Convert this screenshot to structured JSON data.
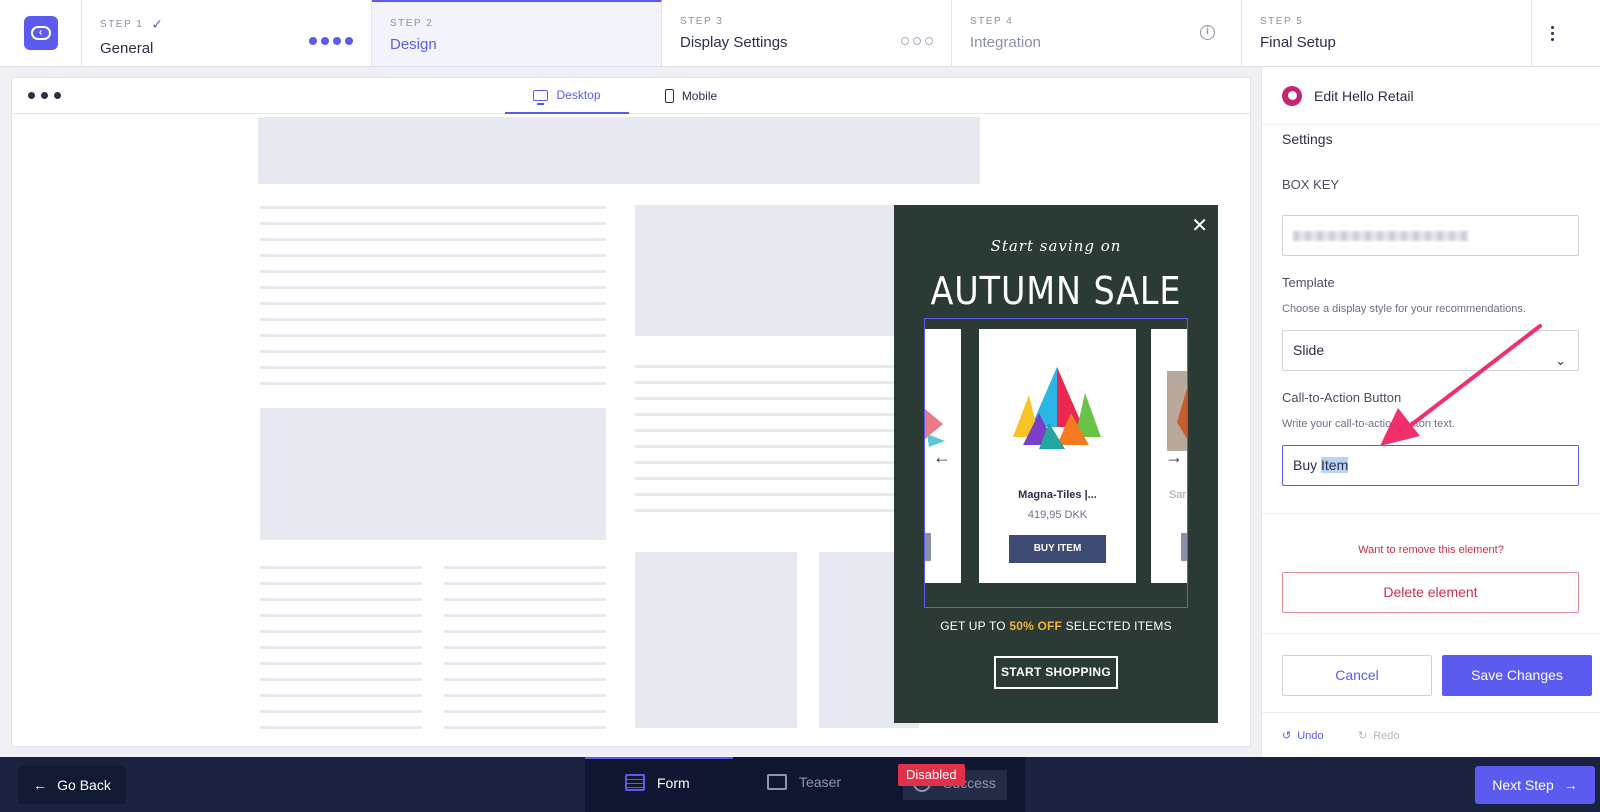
{
  "steps": [
    {
      "num": "STEP 1",
      "name": "General"
    },
    {
      "num": "STEP 2",
      "name": "Design"
    },
    {
      "num": "STEP 3",
      "name": "Display Settings"
    },
    {
      "num": "STEP 4",
      "name": "Integration"
    },
    {
      "num": "STEP 5",
      "name": "Final Setup"
    }
  ],
  "preview": {
    "tabs": {
      "desktop": "Desktop",
      "mobile": "Mobile"
    },
    "popup": {
      "pretitle": "Start saving on",
      "title": "AUTUMN SALE",
      "product_name": "Magna-Tiles |...",
      "product_price": "419,95 DKK",
      "buy_label": "BUY ITEM",
      "side_peek_text": "Sar",
      "promo_prefix": "GET UP TO ",
      "promo_highlight": "50% OFF",
      "promo_suffix": " SELECTED ITEMS",
      "shop_label": "START SHOPPING",
      "prev_arrow": "←",
      "next_arrow": "→"
    }
  },
  "editor": {
    "title": "Edit Hello Retail",
    "section": "Settings",
    "box_key_label": "BOX KEY",
    "template_label": "Template",
    "template_hint": "Choose a display style for your recommendations.",
    "template_value": "Slide",
    "cta_label": "Call-to-Action Button",
    "cta_hint": "Write your call-to-action button text.",
    "cta_value_plain": "Buy ",
    "cta_value_selected": "Item",
    "remove_question": "Want to remove this element?",
    "delete_label": "Delete element",
    "cancel_label": "Cancel",
    "save_label": "Save Changes",
    "undo_label": "Undo",
    "redo_label": "Redo"
  },
  "bottom": {
    "back_label": "Go Back",
    "modes": {
      "form": "Form",
      "teaser": "Teaser",
      "success": "Success"
    },
    "disabled_badge": "Disabled",
    "next_label": "Next Step"
  },
  "colors": {
    "accent": "#5b5bf0",
    "popup_bg": "#2c3a35",
    "promo_highlight": "#f4b23a",
    "danger": "#e0304a",
    "annotation_arrow": "#f0306a"
  }
}
